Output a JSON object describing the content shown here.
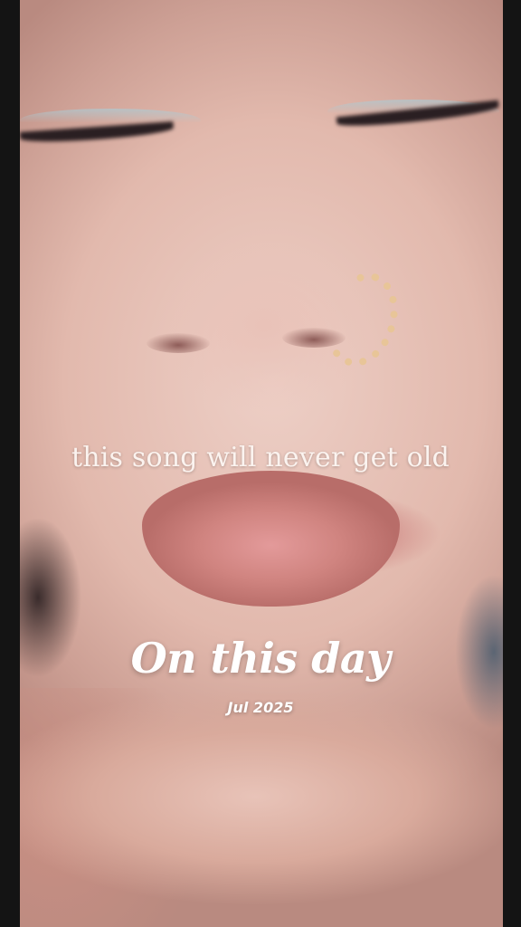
{
  "story": {
    "caption": "this song will never get old",
    "memory_title": "On this day",
    "memory_date": "Jul 2025"
  },
  "colors": {
    "letterbox": "#141414",
    "text": "#ffffff"
  }
}
